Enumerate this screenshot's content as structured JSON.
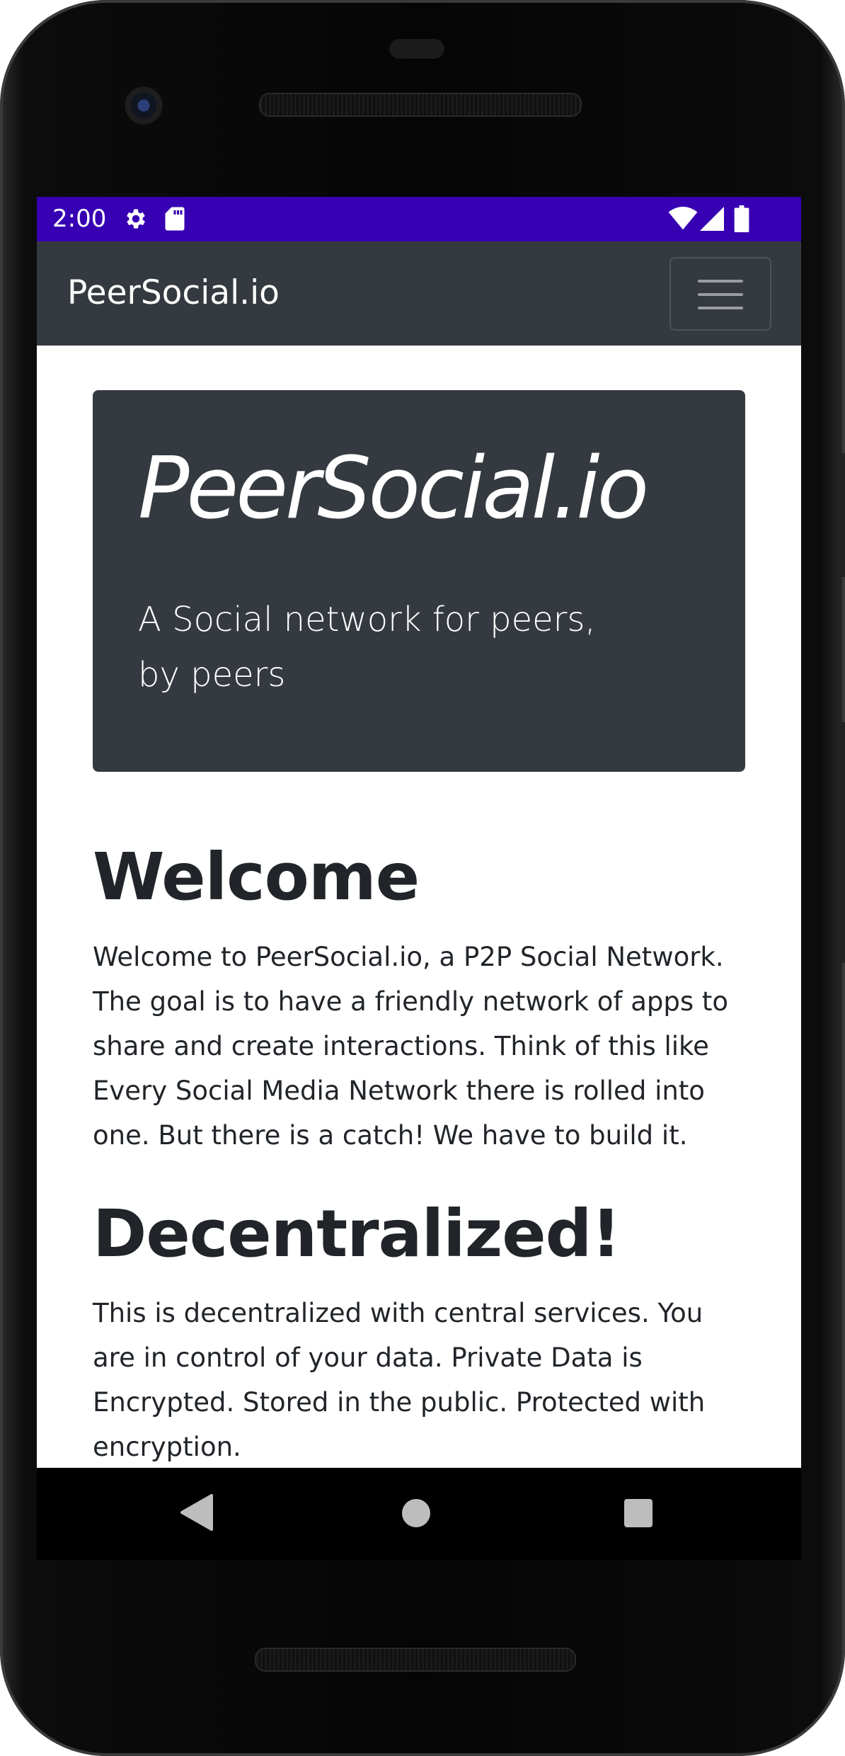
{
  "status_bar": {
    "time": "2:00",
    "background": "#3700b3",
    "icons": [
      "gear-icon",
      "sd-card-icon",
      "wifi-icon",
      "cell-signal-icon",
      "battery-icon"
    ]
  },
  "navbar": {
    "brand": "PeerSocial.io",
    "background": "#343a40",
    "toggler_icon": "hamburger-menu-icon"
  },
  "jumbotron": {
    "title": "PeerSocial.io",
    "lead": "A Social network for peers, by peers",
    "background": "#343a40"
  },
  "sections": [
    {
      "heading": "Welcome",
      "body": "Welcome to PeerSocial.io, a P2P Social Network. The goal is to have a friendly network of apps to share and create interactions. Think of this like Every Social Media Network there is rolled into one. But there is a catch! We have to build it."
    },
    {
      "heading": "Decentralized!",
      "body": "This is decentralized with central services. You are in control of your data. Private Data is Encrypted. Stored in the public. Protected with encryption."
    }
  ],
  "system_nav": {
    "icons": [
      "back-icon",
      "home-icon",
      "recents-icon"
    ]
  }
}
